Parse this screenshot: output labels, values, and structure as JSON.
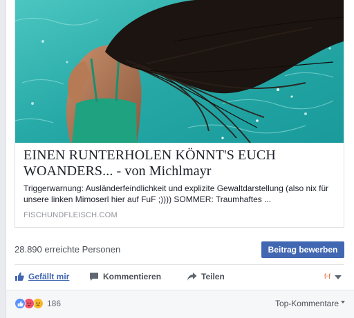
{
  "link": {
    "title": "EINEN RUNTERHOLEN KÖNNT'S EUCH WOANDERS... - von Michlmayr",
    "description": "Triggerwarnung: Ausländerfeindlichkeit und explizite Gewaltdarstellung (also nix für unsere linken Mimoserl hier auf FuF ;)))) SOMMER: Traumhaftes ...",
    "domain": "FISCHUNDFLEISCH.COM",
    "image": "woman-hair-flip-pool-photo"
  },
  "insights": {
    "reach_text": "28.890 erreichte Personen",
    "boost_label": "Beitrag bewerben"
  },
  "actions": {
    "like_label": "Gefällt mir",
    "comment_label": "Kommentieren",
    "share_label": "Teilen",
    "audience_icon": "page-avatar-icon"
  },
  "footer": {
    "reaction_icons": [
      "like-reaction-icon",
      "angry-reaction-icon",
      "sad-reaction-icon"
    ],
    "reaction_count": "186",
    "sort_label": "Top-Kommentare"
  },
  "colors": {
    "accent": "#4267b2",
    "background": "#e9ebee",
    "water": "#2fb3ad"
  }
}
